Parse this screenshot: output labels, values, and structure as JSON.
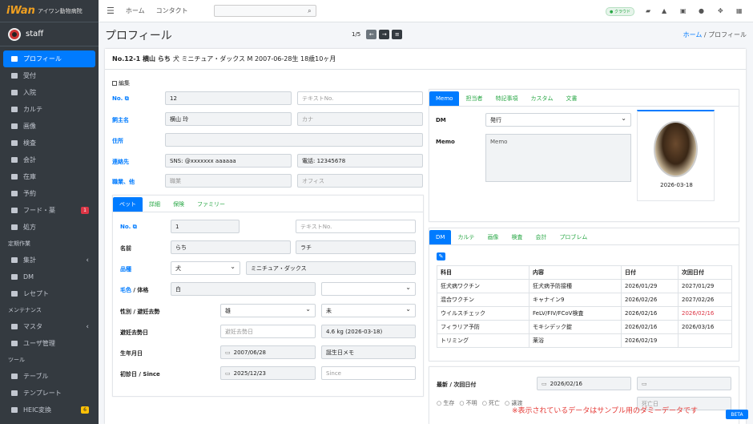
{
  "brand": {
    "logo": "iWan",
    "name": "アイワン動物病院"
  },
  "user": {
    "name": "staff"
  },
  "sidebar": {
    "items": [
      {
        "label": "プロフィール",
        "icon": "user-icon",
        "active": true
      },
      {
        "label": "受付",
        "icon": "dog-icon"
      },
      {
        "label": "入院",
        "icon": "bed-icon"
      },
      {
        "label": "カルテ",
        "icon": "file-icon"
      },
      {
        "label": "画像",
        "icon": "image-icon"
      },
      {
        "label": "検査",
        "icon": "syringe-icon"
      },
      {
        "label": "会計",
        "icon": "calculator-icon"
      },
      {
        "label": "在庫",
        "icon": "box-icon"
      },
      {
        "label": "予約",
        "icon": "calendar-icon"
      },
      {
        "label": "フード・薬",
        "icon": "pill-icon",
        "badge": "1"
      },
      {
        "label": "処方",
        "icon": "prescription-icon"
      }
    ],
    "header_periodic": "定期作業",
    "periodic": [
      {
        "label": "集計",
        "icon": "chart-pie-icon",
        "chevron": "‹"
      },
      {
        "label": "DM",
        "icon": "mail-icon"
      },
      {
        "label": "レセプト",
        "icon": "receipt-icon"
      }
    ],
    "header_maint": "メンテナンス",
    "maint": [
      {
        "label": "マスタ",
        "icon": "gear-icon",
        "chevron": "‹"
      },
      {
        "label": "ユーザ管理",
        "icon": "users-icon"
      }
    ],
    "header_tools": "ツール",
    "tools": [
      {
        "label": "テーブル",
        "icon": "table-icon"
      },
      {
        "label": "テンプレート",
        "icon": "template-icon"
      },
      {
        "label": "HEIC変換",
        "icon": "convert-icon",
        "badge": "6"
      }
    ]
  },
  "topbar": {
    "home": "ホーム",
    "contact": "コンタクト",
    "cloud": "● クラウド"
  },
  "page": {
    "title": "プロフィール",
    "pager": "1/5",
    "breadcrumb_home": "ホーム",
    "breadcrumb_sep": "/",
    "breadcrumb_current": "プロフィール"
  },
  "header": {
    "no": "No.12-1 横山 らち",
    "rest": "犬 ミニチュア・ダックス M 2007-06-28生 18歳10ヶ月"
  },
  "edit_label": "編集",
  "owner": {
    "no_label": "No.",
    "no": "12",
    "no_ph": "テキストNo.",
    "name_label": "飼主名",
    "name": "横山 玲",
    "kana_ph": "カナ",
    "address_label": "住所",
    "address": "",
    "contact_label": "連絡先",
    "sns": "SNS: @xxxxxxx aaaaaa",
    "phone": "電話: 12345678",
    "job_label": "職業、他",
    "job_ph": "職業",
    "office_ph": "オフィス"
  },
  "pet_tabs": [
    "ペット",
    "詳細",
    "保険",
    "ファミリー"
  ],
  "pet": {
    "no_label": "No.",
    "no": "1",
    "no_ph": "テキストNo.",
    "name_label": "名前",
    "name": "らち",
    "kana": "ラチ",
    "breed_label": "品種",
    "species": "犬",
    "breed": "ミニチュア・ダックス",
    "color_label_a": "毛色",
    "color_label_b": " / 体格",
    "color": "白",
    "sex_label": "性別 / 避妊去勢",
    "sex": "雄",
    "neuter": "未",
    "neuter_date_label": "避妊去勢日",
    "neuter_date_ph": "避妊去勢日",
    "weight": "4.6 kg (2026-03-18)",
    "birth_label": "生年月日",
    "birth": "2007/06/28",
    "birth_memo": "誕生日メモ",
    "first_label": "初診日 / Since",
    "first": "2025/12/23",
    "since_ph": "Since"
  },
  "memo_tabs": [
    "Memo",
    "担当者",
    "特記事項",
    "カスタム",
    "文書"
  ],
  "memo": {
    "dm_label": "DM",
    "dm": "発行",
    "memo_label": "Memo",
    "memo_ph": "Memo",
    "photo_date": "2026-03-18"
  },
  "dm_tabs": [
    "DM",
    "カルテ",
    "画像",
    "検査",
    "会計",
    "プロブレム"
  ],
  "dm_table": {
    "headers": [
      "科目",
      "内容",
      "日付",
      "次回日付"
    ],
    "rows": [
      [
        "狂犬病ワクチン",
        "狂犬病予防接種",
        "2026/01/29",
        "2027/01/29"
      ],
      [
        "混合ワクチン",
        "キャナイン9",
        "2026/02/26",
        "2027/02/26"
      ],
      [
        "ウイルスチェック",
        "FeLV/FIV/FCoV検査",
        "2026/02/16",
        "2026/02/16"
      ],
      [
        "フィラリア予防",
        "モキシデック錠",
        "2026/02/16",
        "2026/03/16"
      ],
      [
        "トリミング",
        "薬浴",
        "2026/02/19",
        ""
      ]
    ]
  },
  "latest": {
    "label": "最新 / 次回日付",
    "date": "2026/02/16",
    "radios": [
      "○ 生存",
      "○ 不明",
      "○ 死亡",
      "○ 譲渡"
    ],
    "death_ph": "死亡日"
  },
  "footer": {
    "dummy_notice": "※表示されているデータはサンプル用のダミーデータです",
    "beta": "BETA"
  }
}
